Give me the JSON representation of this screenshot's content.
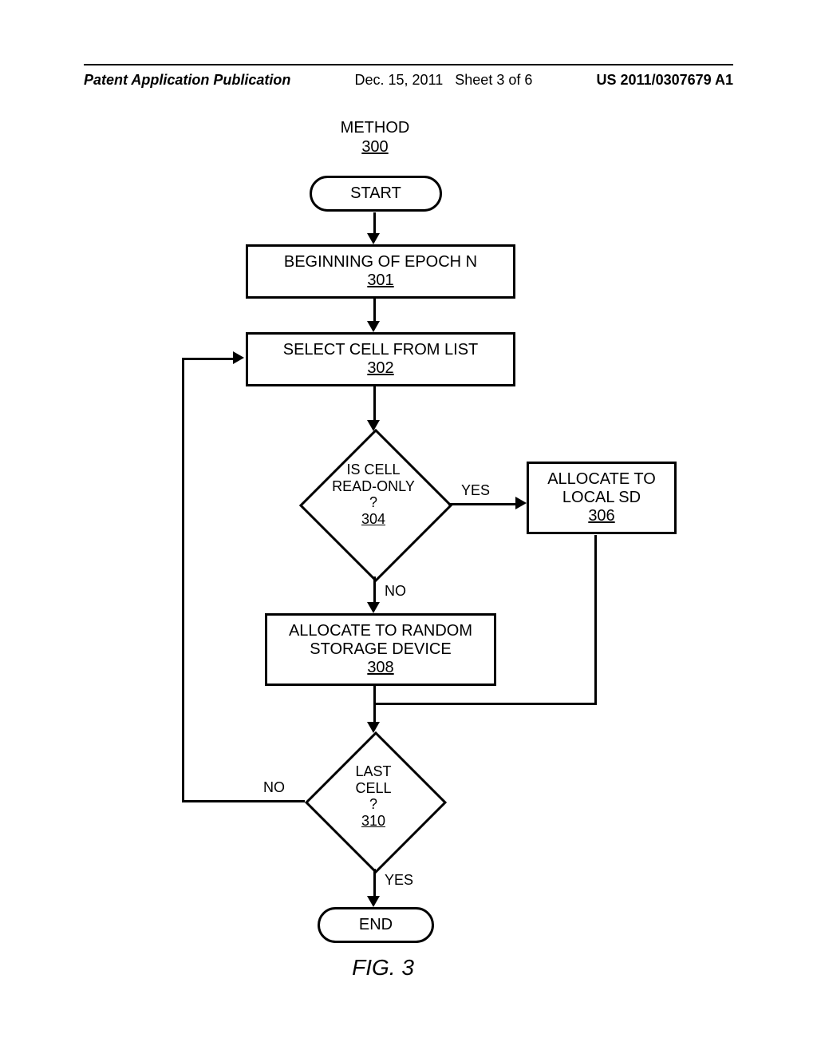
{
  "header": {
    "left": "Patent Application Publication",
    "center_date": "Dec. 15, 2011",
    "center_sheet": "Sheet 3 of 6",
    "right": "US 2011/0307679 A1"
  },
  "title": {
    "text": "METHOD",
    "ref": "300"
  },
  "start": "START",
  "end": "END",
  "step_epoch": {
    "text": "BEGINNING OF EPOCH N",
    "ref": "301"
  },
  "step_select": {
    "text": "SELECT CELL FROM LIST",
    "ref": "302"
  },
  "dec_readonly": {
    "l1": "IS CELL",
    "l2": "READ-ONLY",
    "l3": "?",
    "ref": "304"
  },
  "step_local": {
    "l1": "ALLOCATE TO",
    "l2": "LOCAL SD",
    "ref": "306"
  },
  "step_random": {
    "l1": "ALLOCATE TO RANDOM",
    "l2": "STORAGE DEVICE",
    "ref": "308"
  },
  "dec_last": {
    "l1": "LAST",
    "l2": "CELL",
    "l3": "?",
    "ref": "310"
  },
  "labels": {
    "yes": "YES",
    "no": "NO"
  },
  "figure": "FIG. 3"
}
